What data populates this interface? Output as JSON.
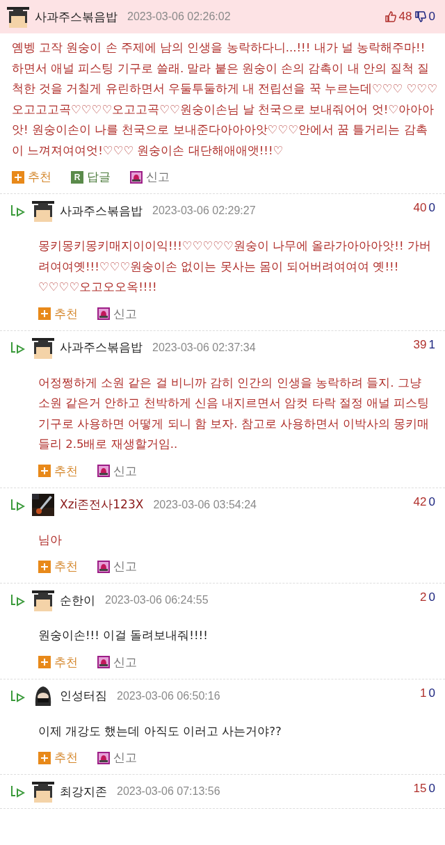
{
  "comments": [
    {
      "kind": "top",
      "author": {
        "name": "사과주스볶음밥",
        "color": "#222222"
      },
      "avatar": {
        "kind": "cap"
      },
      "date": "2023-03-06 02:26:02",
      "up": "48",
      "down": "0",
      "body": {
        "text": "옘벵 고작 원숭이 손 주제에 남의 인생을 농락하다니...!!! 내가 널 농락해주마!! 하면서 애널 피스팅 기구로 쓸래. 말라 붙은 원숭이 손의 감촉이 내 안의 질척 질척한 것을 거칠게 유린하면서 우둘투둘하게 내 전립선을 꾹 누르는데♡♡♡ ♡♡♡오고고고곡♡♡♡♡오고고곡♡♡원숭이손님 날 천국으로 보내줘어어 엇!♡아아아앗! 원숭이손이 나를 천국으로 보내준다아아아앗♡♡♡안에서 꿈 틀거리는 감촉이 느껴져여여엇!♡♡♡ 원숭이손 대단해애애앳!!!♡",
        "color": "#b0302c"
      },
      "actions": [
        {
          "kind": "recommend",
          "label": "추천"
        },
        {
          "kind": "reply",
          "label": "답글",
          "badge": "R"
        },
        {
          "kind": "report",
          "label": "신고"
        }
      ]
    },
    {
      "kind": "reply",
      "author": {
        "name": "사과주스볶음밥",
        "color": "#222222"
      },
      "avatar": {
        "kind": "cap"
      },
      "date": "2023-03-06 02:29:27",
      "up": "40",
      "down": "0",
      "body": {
        "text": "몽키몽키몽키매지이이익!!!♡♡♡♡♡원숭이 나무에 올라가아아아앗!! 가버려여여옛!!!♡♡♡원숭이손 없이는 못사는 몸이 되어버려여여여 옛!!!♡♡♡♡오고오오옥!!!!",
        "color": "#b0302c"
      },
      "actions": [
        {
          "kind": "recommend",
          "label": "추천"
        },
        {
          "kind": "report",
          "label": "신고"
        }
      ]
    },
    {
      "kind": "reply",
      "author": {
        "name": "사과주스볶음밥",
        "color": "#222222"
      },
      "avatar": {
        "kind": "cap"
      },
      "date": "2023-03-06 02:37:34",
      "up": "39",
      "down": "1",
      "body": {
        "text": "어정쩡하게 소원 같은 걸 비니까 감히 인간의 인생을 농락하려 들지. 그냥 소원 같은거 안하고 천박하게 신음 내지르면서 암컷 타락 절정 애널 피스팅 기구로 사용하면 어떻게 되니 함 보자. 참고로 사용하면서 이박사의 몽키매들리 2.5배로 재생할거임..",
        "color": "#b0302c"
      },
      "actions": [
        {
          "kind": "recommend",
          "label": "추천"
        },
        {
          "kind": "report",
          "label": "신고"
        }
      ]
    },
    {
      "kind": "reply",
      "author": {
        "name": "Xzi존전사123X",
        "color": "#8b1a1a"
      },
      "avatar": {
        "kind": "picture"
      },
      "date": "2023-03-06 03:54:24",
      "up": "42",
      "down": "0",
      "body": {
        "text": "님아",
        "color": "#b0302c"
      },
      "actions": [
        {
          "kind": "recommend",
          "label": "추천"
        },
        {
          "kind": "report",
          "label": "신고"
        }
      ]
    },
    {
      "kind": "reply",
      "author": {
        "name": "순한이",
        "color": "#222222"
      },
      "avatar": {
        "kind": "cap"
      },
      "date": "2023-03-06 06:24:55",
      "up": "2",
      "down": "0",
      "body": {
        "text": "원숭이손!!! 이걸 돌려보내줘!!!!",
        "color": "#222222"
      },
      "actions": [
        {
          "kind": "recommend",
          "label": "추천"
        },
        {
          "kind": "report",
          "label": "신고"
        }
      ]
    },
    {
      "kind": "reply",
      "author": {
        "name": "인성터짐",
        "color": "#222222"
      },
      "avatar": {
        "kind": "hooded"
      },
      "date": "2023-03-06 06:50:16",
      "up": "1",
      "down": "0",
      "body": {
        "text": "이제 개강도 했는데 아직도 이러고 사는거야??",
        "color": "#222222"
      },
      "actions": [
        {
          "kind": "recommend",
          "label": "추천"
        },
        {
          "kind": "report",
          "label": "신고"
        }
      ]
    },
    {
      "kind": "reply",
      "author": {
        "name": "최강지존",
        "color": "#222222"
      },
      "avatar": {
        "kind": "cap"
      },
      "date": "2023-03-06 07:13:56",
      "up": "15",
      "down": "0"
    }
  ]
}
